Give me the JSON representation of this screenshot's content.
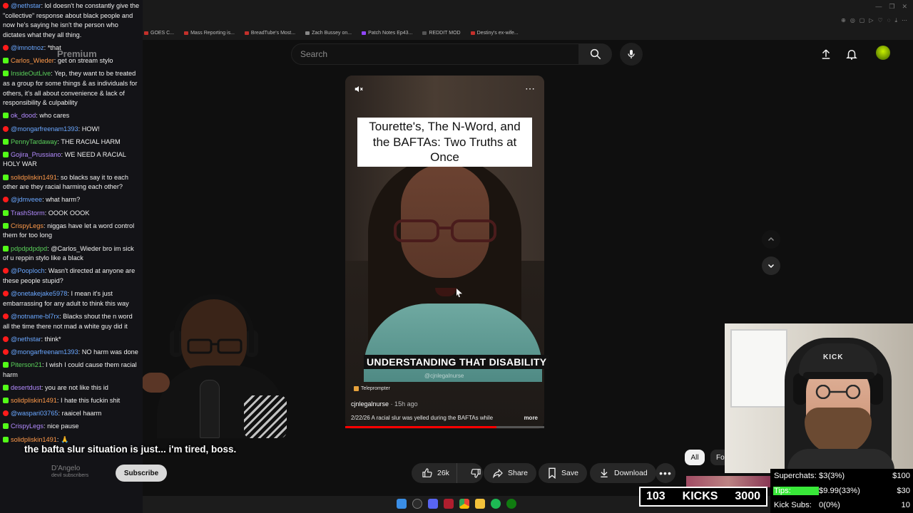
{
  "browser": {
    "bookmarks": [
      "GOES C...",
      "Mass Reporting is...",
      "BreadTube's Most...",
      "Zach Bussey on...",
      "Patch Notes Ep43...",
      "REDDIT MOD",
      "Destiny's ex-wife..."
    ]
  },
  "youtube": {
    "premium_label": "Premium",
    "search_placeholder": "Search",
    "icons": [
      "search-icon",
      "mic-icon",
      "upload-icon",
      "bell-icon"
    ]
  },
  "chat": {
    "messages": [
      {
        "platform": "yt",
        "user": "@nethstar",
        "text": "lol doesn't he constantly give the \"collective\" response about black people and now he's saying he isn't the person who dictates what they all thing."
      },
      {
        "platform": "yt",
        "user": "@imnotnoz",
        "text": "*that"
      },
      {
        "platform": "kick",
        "user": "Carlos_Wieder",
        "text": "get on stream stylo"
      },
      {
        "platform": "kick",
        "user": "InsideOutLive",
        "text": "Yep, they want to be treated as a group for some things & as individuals for others, it's all about convenience & lack of responsibility & culpability"
      },
      {
        "platform": "kick",
        "user": "ok_dood",
        "text": "who cares"
      },
      {
        "platform": "yt",
        "user": "@mongarfreenam1393",
        "text": "HOW!"
      },
      {
        "platform": "kick",
        "user": "PennyTardaway",
        "text": "THE RACIAL HARM"
      },
      {
        "platform": "kick",
        "user": "Gojira_Prussiano",
        "text": "WE NEED A RACIAL HOLY WAR"
      },
      {
        "platform": "kick",
        "user": "solidpliskin1491",
        "text": "so blacks say it to each other are they racial harming each other?"
      },
      {
        "platform": "yt",
        "user": "@jdmveee",
        "text": "what harm?"
      },
      {
        "platform": "kick",
        "user": "TrashStorm",
        "text": "OOOK OOOK"
      },
      {
        "platform": "kick",
        "user": "CrispyLegs",
        "text": "niggas have let a word control them for too long"
      },
      {
        "platform": "kick",
        "user": "pdpdpdpdpd",
        "text": "@Carlos_Wieder bro im sick of u reppin stylo like a black"
      },
      {
        "platform": "yt",
        "user": "@Pooploch",
        "text": "Wasn't directed at anyone are these people stupid?"
      },
      {
        "platform": "yt",
        "user": "@onetakejake5978",
        "text": "I mean it's just embarrassing for any adult to think this way"
      },
      {
        "platform": "yt",
        "user": "@notname-bl7rx",
        "text": "Blacks shout the n word all the time there not mad a white guy did it"
      },
      {
        "platform": "yt",
        "user": "@nethstar",
        "text": "think*"
      },
      {
        "platform": "yt",
        "user": "@mongarfreenam1393",
        "text": "NO harm was done"
      },
      {
        "platform": "kick",
        "user": "Piterson21",
        "text": "I wish I could cause them racial harm"
      },
      {
        "platform": "kick",
        "user": "desertdust",
        "text": "you are not like this id"
      },
      {
        "platform": "kick",
        "user": "solidpliskin1491",
        "text": "I hate this fuckin shit"
      },
      {
        "platform": "yt",
        "user": "@waspari03765",
        "text": "raaicel haarm"
      },
      {
        "platform": "kick",
        "user": "CrispyLegs",
        "text": "nice pause"
      },
      {
        "platform": "kick",
        "user": "solidpliskin1491",
        "text": "🙏"
      }
    ]
  },
  "video": {
    "title": "Tourette's, The N-Word, and the BAFTAs: Two Truths at Once",
    "caption": "UNDERSTANDING THAT DISABILITY",
    "handle_overlay": "@cjnlegalnurse",
    "teleprompter": "Teleprompter",
    "channel_handle": "cjnlegalnurse",
    "time_ago": "· 15h ago",
    "description": "2/22/26 A racial slur was yelled during the BAFTAs while",
    "more": "more",
    "progress": 0.76
  },
  "subtitle": "the bafta slur situation is just... i'm tired, boss.",
  "actions": {
    "channel_name": "D'Angelo",
    "channel_subs": "devil subscribers",
    "subscribe": "Subscribe",
    "likes": "26k",
    "share": "Share",
    "save": "Save",
    "download": "Download"
  },
  "chips": {
    "all": "All",
    "partial": "Fo"
  },
  "goal": {
    "current": "103",
    "label": "KICKS",
    "target": "3000"
  },
  "stats": {
    "superchats_label": "Superchats:",
    "superchats_value": "$3(3%)",
    "superchats_goal": "$100",
    "tips_label": "Tips:",
    "tips_value": "$9.99(33%)",
    "tips_goal": "$30",
    "kicksubs_label": "Kick Subs:",
    "kicksubs_value": "0(0%)",
    "kicksubs_goal": "10"
  },
  "colors": {
    "kick_green": "#53fc18",
    "youtube_red": "#ff0000",
    "tips_green": "#39e839"
  }
}
